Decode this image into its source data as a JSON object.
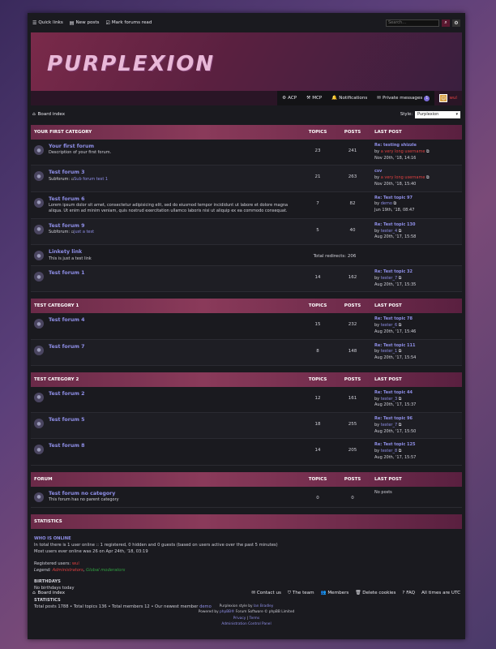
{
  "topbar": {
    "quick_links": "Quick links",
    "new_posts": "New posts",
    "mark_read": "Mark forums read",
    "search_placeholder": "Search…"
  },
  "logo": "PURPLEXION",
  "usernav": {
    "acp": "ACP",
    "mcp": "MCP",
    "notifications": "Notifications",
    "pm": "Private messages",
    "pm_count": "1",
    "username": "wul"
  },
  "crumb": {
    "board_index": "Board index",
    "style_label": "Style:",
    "style_value": "Purplexion"
  },
  "columns": {
    "topics": "TOPICS",
    "posts": "POSTS",
    "last_post": "LAST POST"
  },
  "categories": [
    {
      "name": "YOUR FIRST CATEGORY",
      "forums": [
        {
          "title": "Your first forum",
          "desc": "Description of your first forum.",
          "topics": "23",
          "posts": "241",
          "last_title": "Re: testing shizzle",
          "by": "by",
          "last_user": "a very long username",
          "last_date": "Nov 20th, '18, 14:16",
          "user_red": true
        },
        {
          "title": "Test forum 3",
          "sub_label": "Subforum:",
          "sub_link": "Sub forum test 1",
          "topics": "21",
          "posts": "263",
          "last_title": "csv",
          "by": "by",
          "last_user": "a very long username",
          "last_date": "Nov 20th, '18, 15:40",
          "user_red": true
        },
        {
          "title": "Test forum 6",
          "desc": "Lorem ipsum dolor sit amet, consectetur adipisicing elit, sed do eiusmod tempor incididunt ut labore et dolore magna aliqua. Ut enim ad minim veniam, quis nostrud exercitation ullamco laboris nisi ut aliquip ex ea commodo consequat.",
          "topics": "7",
          "posts": "82",
          "last_title": "Re: Test topic 97",
          "by": "by",
          "last_user": "demo",
          "last_date": "Jun 19th, '18, 08:47"
        },
        {
          "title": "Test forum 9",
          "sub_label": "Subforum:",
          "sub_link": "just a test",
          "topics": "5",
          "posts": "40",
          "last_title": "Re: Test topic 130",
          "by": "by",
          "last_user": "tester_4",
          "last_date": "Aug 20th, '17, 15:58"
        },
        {
          "title": "Linkety link",
          "desc": "This is just a test link",
          "redirects": "Total redirects: 206"
        },
        {
          "title": "Test forum 1",
          "topics": "14",
          "posts": "162",
          "last_title": "Re: Test topic 32",
          "by": "by",
          "last_user": "tester_7",
          "last_date": "Aug 20th, '17, 15:35"
        }
      ]
    },
    {
      "name": "TEST CATEGORY 1",
      "forums": [
        {
          "title": "Test forum 4",
          "topics": "15",
          "posts": "232",
          "last_title": "Re: Test topic 78",
          "by": "by",
          "last_user": "tester_6",
          "last_date": "Aug 20th, '17, 15:46"
        },
        {
          "title": "Test forum 7",
          "topics": "8",
          "posts": "148",
          "last_title": "Re: Test topic 111",
          "by": "by",
          "last_user": "tester_1",
          "last_date": "Aug 20th, '17, 15:54"
        }
      ]
    },
    {
      "name": "TEST CATEGORY 2",
      "forums": [
        {
          "title": "Test forum 2",
          "topics": "12",
          "posts": "161",
          "last_title": "Re: Test topic 44",
          "by": "by",
          "last_user": "tester_3",
          "last_date": "Aug 20th, '17, 15:37"
        },
        {
          "title": "Test forum 5",
          "topics": "18",
          "posts": "255",
          "last_title": "Re: Test topic 96",
          "by": "by",
          "last_user": "tester_7",
          "last_date": "Aug 20th, '17, 15:50"
        },
        {
          "title": "Test forum 8",
          "topics": "14",
          "posts": "205",
          "last_title": "Re: Test topic 125",
          "by": "by",
          "last_user": "tester_8",
          "last_date": "Aug 20th, '17, 15:57"
        }
      ]
    },
    {
      "name": "FORUM",
      "forums": [
        {
          "title": "Test forum no category",
          "desc": "This forum has no parent category",
          "topics": "0",
          "posts": "0",
          "no_posts": "No posts"
        }
      ]
    }
  ],
  "stats": {
    "header": "STATISTICS",
    "who_online": "WHO IS ONLINE",
    "online_line1": "In total there is 1 user online :: 1 registered, 0 hidden and 0 guests (based on users active over the past 5 minutes)",
    "online_line2": "Most users ever online was 26 on Apr 24th, '18, 03:19",
    "registered_label": "Registered users:",
    "registered_user": "wul",
    "legend_label": "Legend:",
    "legend_admin": "Administrators",
    "legend_sep": ",",
    "legend_mod": "Global moderators",
    "birthdays": "BIRTHDAYS",
    "no_birthdays": "No birthdays today",
    "statistics": "STATISTICS",
    "totals": "Total posts 1788 • Total topics 136 • Total members 12 • Our newest member",
    "newest": "demo"
  },
  "footer": {
    "board_index": "Board index",
    "contact": "Contact us",
    "team": "The team",
    "members": "Members",
    "delete_cookies": "Delete cookies",
    "faq": "FAQ",
    "timezone": "All times are UTC"
  },
  "copyright": {
    "style_by": "Purplexion style by",
    "author": "Ian Bradley",
    "powered": "Powered by",
    "phpbb": "phpBB®",
    "software": "Forum Software © phpBB Limited",
    "privacy": "Privacy",
    "sep": "|",
    "terms": "Terms",
    "acp_link": "Administration Control Panel"
  }
}
